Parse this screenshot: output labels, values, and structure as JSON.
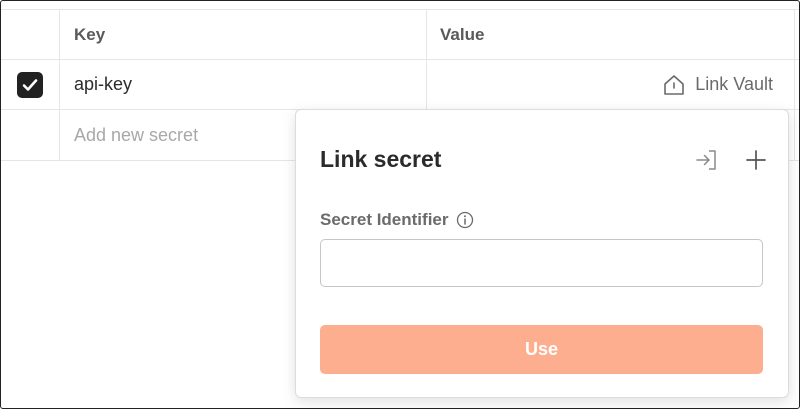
{
  "table": {
    "columns": {
      "key": "Key",
      "value": "Value"
    },
    "rows": [
      {
        "checked": true,
        "key": "api-key",
        "value_action": "Link Vault"
      }
    ],
    "new_row_placeholder": "Add new secret"
  },
  "popover": {
    "title": "Link secret",
    "field_label": "Secret Identifier",
    "field_value": "",
    "use_button": "Use"
  },
  "colors": {
    "accent_disabled": "#fcae8f",
    "checkbox": "#222222"
  },
  "icons": {
    "checkbox": "check-icon",
    "link_vault": "vault-icon",
    "link_existing": "sign-in-icon",
    "add": "plus-icon",
    "info": "info-icon"
  }
}
